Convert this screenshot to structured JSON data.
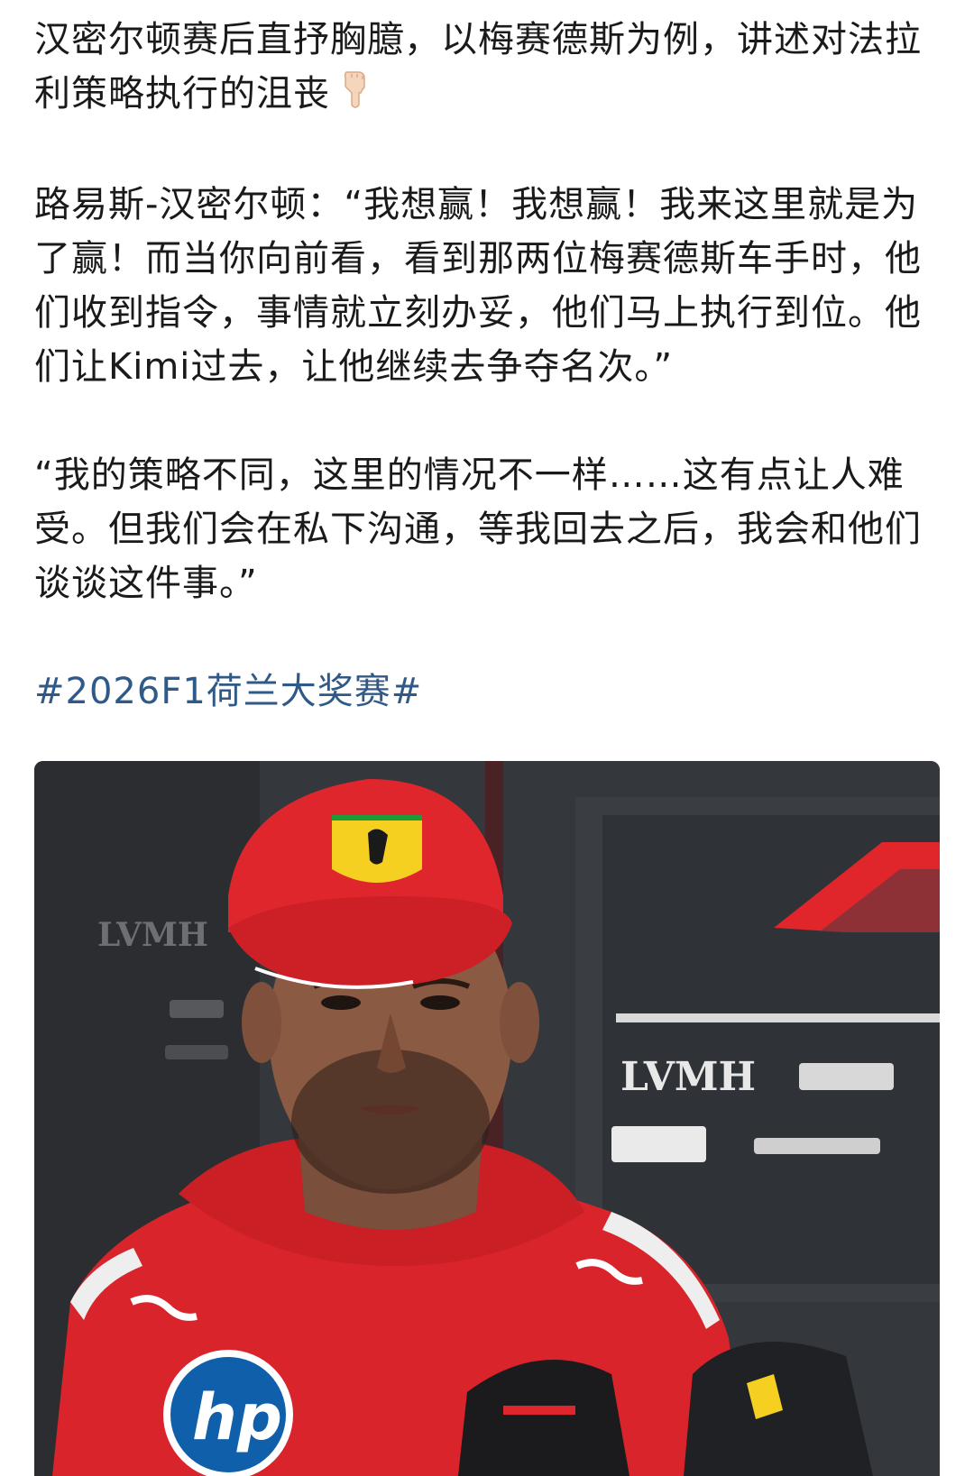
{
  "post": {
    "title": "汉密尔顿赛后直抒胸臆，以梅赛德斯为例，讲述对法拉利策略执行的沮丧",
    "quote1": "路易斯-汉密尔顿：“我想赢！我想赢！我来这里就是为了赢！而当你向前看，看到那两位梅赛德斯车手时，他们收到指令，事情就立刻办妥，他们马上执行到位。他们让Kimi过去，让他继续去争夺名次。”",
    "quote2": "“我的策略不同，这里的情况不一样……这有点让人难受。但我们会在私下沟通，等我回去之后，我会和他们谈谈这件事。”",
    "hashtag": "#2026F1荷兰大奖赛#",
    "emoji": "pointing-down-hand"
  },
  "photo": {
    "sponsor_boards": [
      "LVMH",
      "LVMH"
    ],
    "colors": {
      "ferrari_red": "#d8242a",
      "background": "#2e3135",
      "hashtag": "#2f5a88"
    }
  }
}
